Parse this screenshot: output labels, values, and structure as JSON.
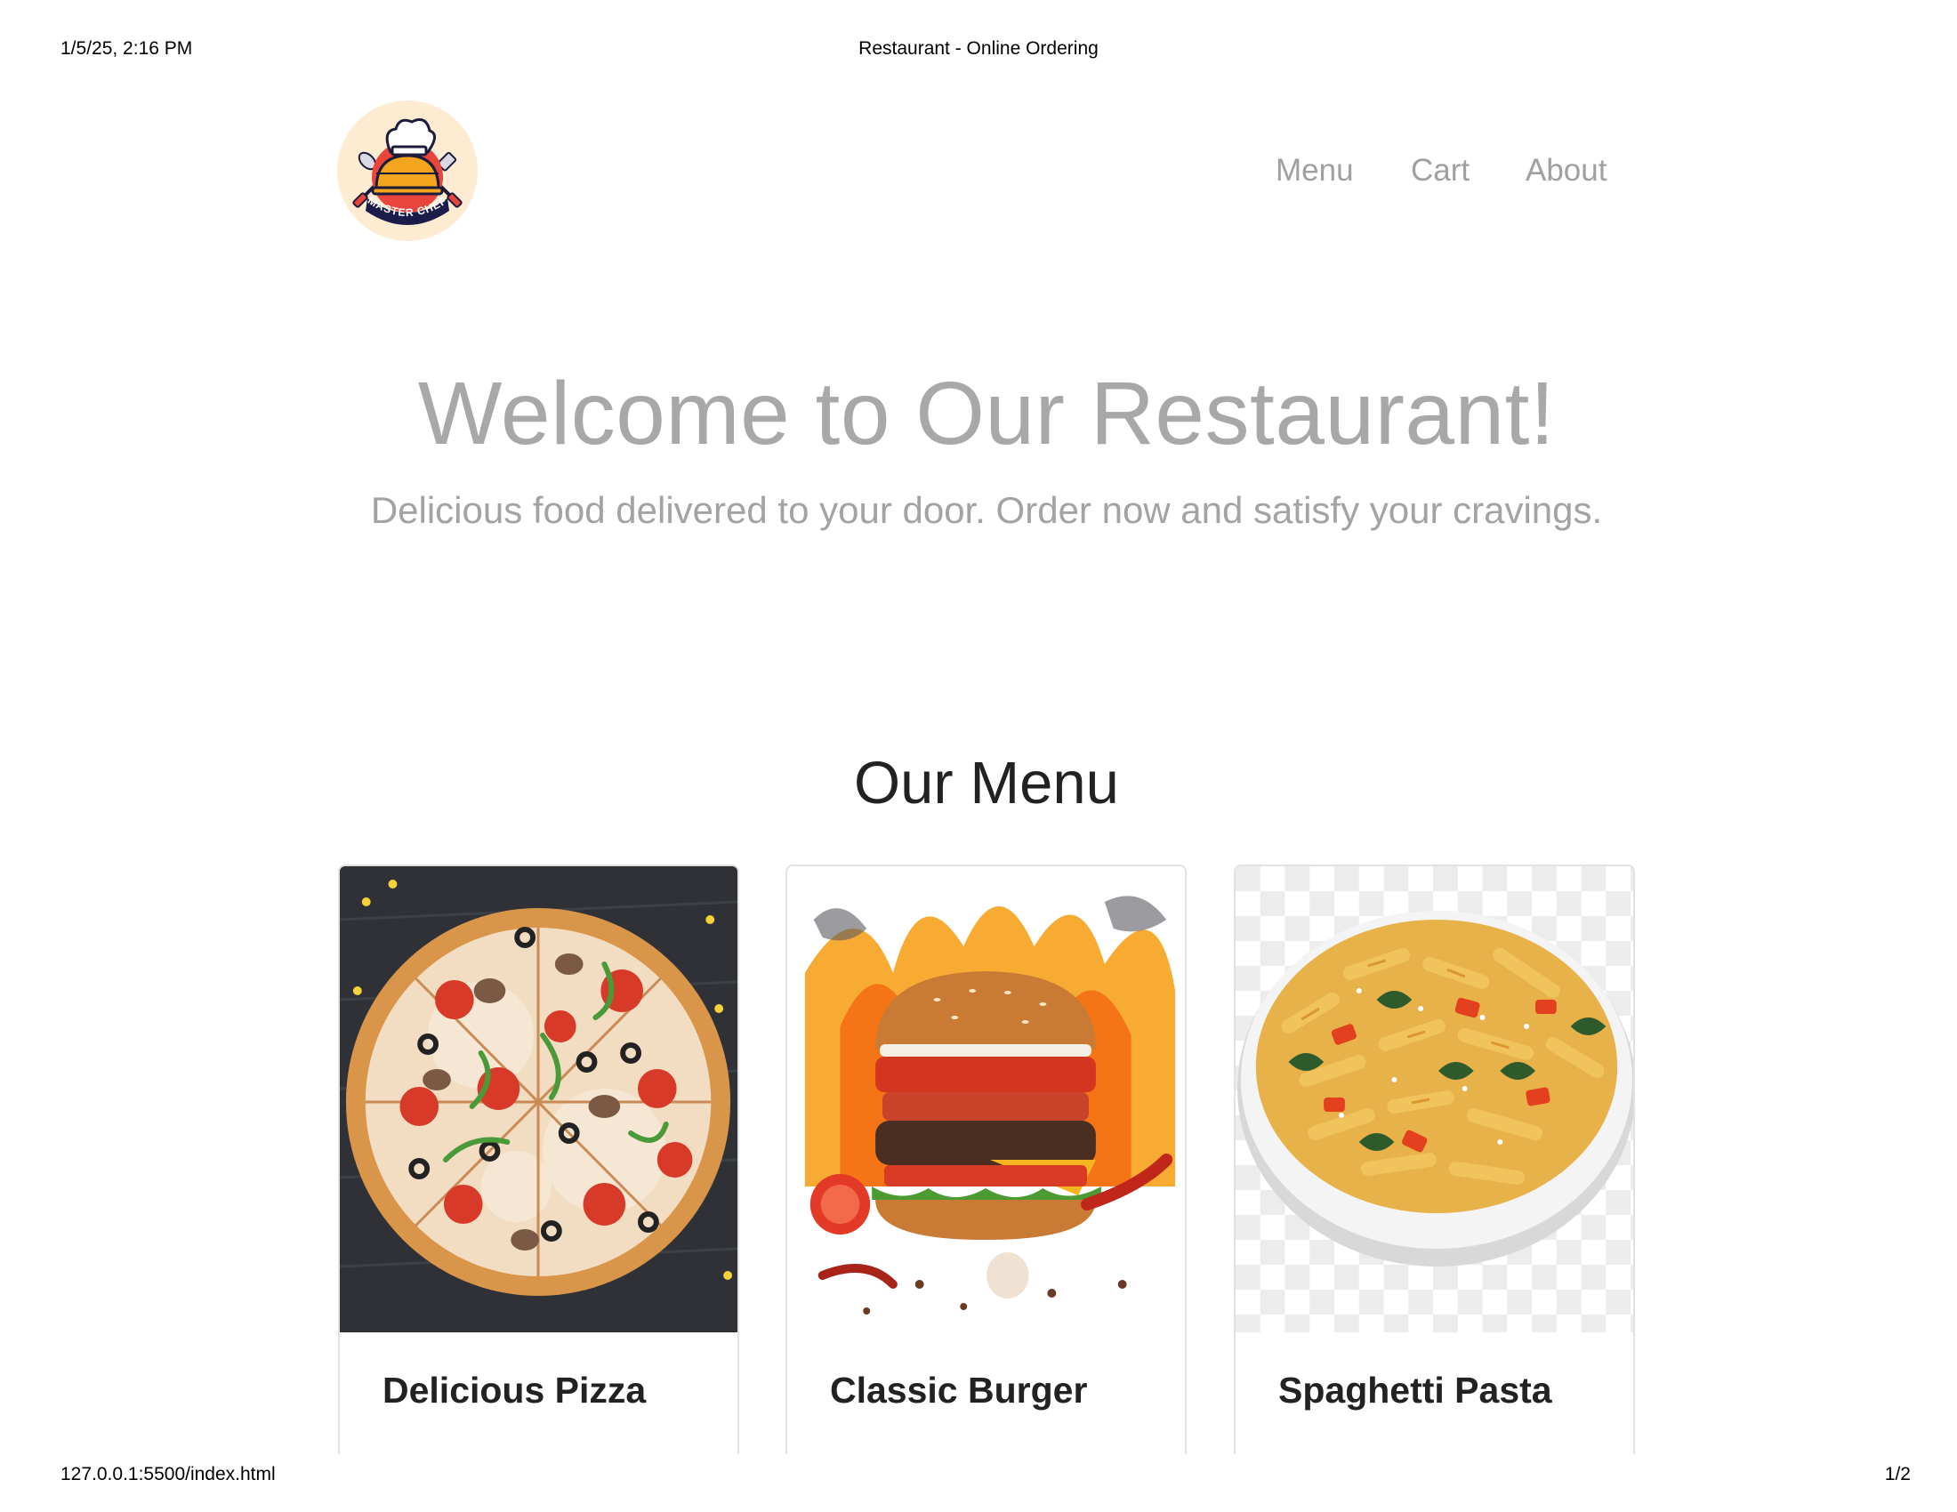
{
  "print_header": {
    "datetime": "1/5/25, 2:16 PM",
    "page_title": "Restaurant - Online Ordering"
  },
  "print_footer": {
    "url": "127.0.0.1:5500/index.html",
    "page_number": "1/2"
  },
  "logo": {
    "text": "MASTER CHEF",
    "background": "#fdebd2"
  },
  "nav": {
    "items": [
      {
        "label": "Menu"
      },
      {
        "label": "Cart"
      },
      {
        "label": "About"
      }
    ],
    "color": "#a0a0a0"
  },
  "hero": {
    "title": "Welcome to Our Restaurant!",
    "subtitle": "Delicious food delivered to your door. Order now and satisfy your cravings."
  },
  "menu": {
    "title": "Our Menu",
    "items": [
      {
        "name": "Delicious Pizza",
        "image_icon": "pizza-image"
      },
      {
        "name": "Classic Burger",
        "image_icon": "burger-image"
      },
      {
        "name": "Spaghetti Pasta",
        "image_icon": "pasta-image"
      }
    ]
  }
}
